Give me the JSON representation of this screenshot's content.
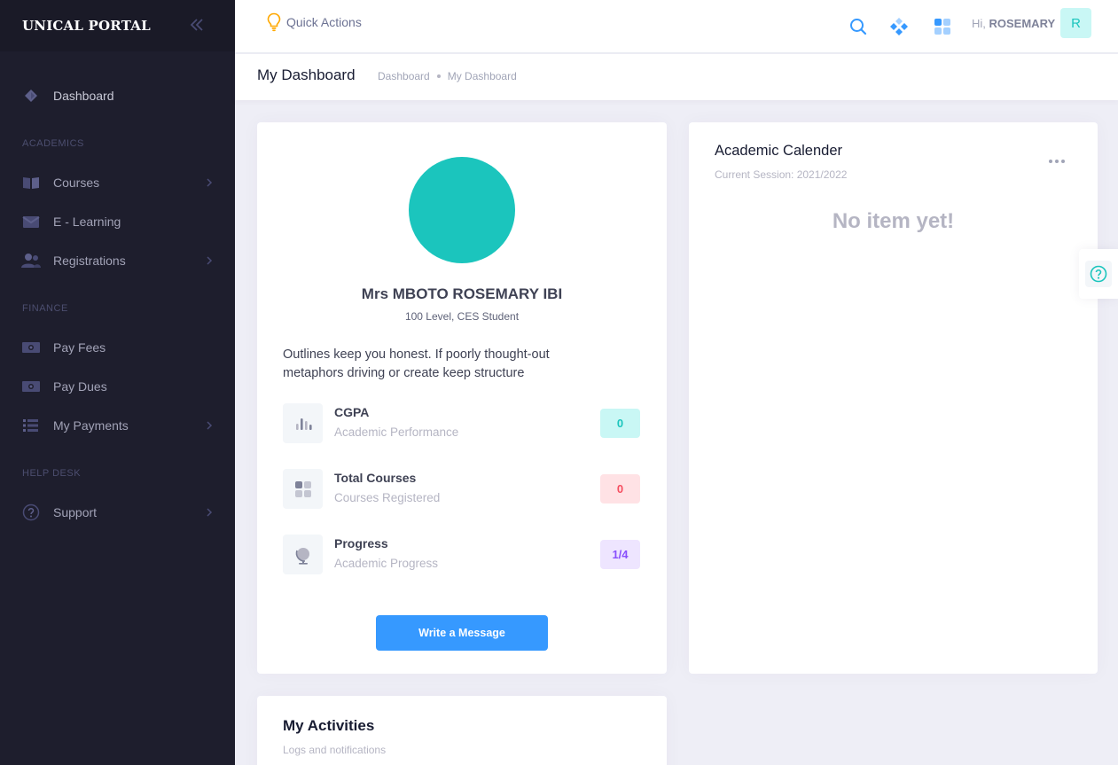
{
  "brand": {
    "name": "UNICAL PORTAL"
  },
  "sidebar": {
    "dashboard": {
      "label": "Dashboard"
    },
    "sections": {
      "academics": "ACADEMICS",
      "finance": "FINANCE",
      "help_desk": "HELP DESK"
    },
    "items": {
      "courses": "Courses",
      "elearning": "E - Learning",
      "registrations": "Registrations",
      "pay_fees": "Pay Fees",
      "pay_dues": "Pay Dues",
      "my_payments": "My Payments",
      "support": "Support"
    }
  },
  "header": {
    "quick_actions": "Quick Actions",
    "greeting_prefix": "Hi,",
    "user_name": "ROSEMARY",
    "avatar_letter": "R"
  },
  "subheader": {
    "title": "My Dashboard",
    "breadcrumb": [
      "Dashboard",
      "My Dashboard"
    ]
  },
  "profile": {
    "name": "Mrs MBOTO ROSEMARY IBI",
    "subtitle": "100 Level, CES Student",
    "bio": "Outlines keep you honest. If poorly thought-out metaphors driving or create keep structure",
    "stats": [
      {
        "title": "CGPA",
        "desc": "Academic Performance",
        "value": "0",
        "color": "#1bc5bd",
        "bg": "#c9f7f5"
      },
      {
        "title": "Total Courses",
        "desc": "Courses Registered",
        "value": "0",
        "color": "#f64e60",
        "bg": "#ffe2e5"
      },
      {
        "title": "Progress",
        "desc": "Academic Progress",
        "value": "1/4",
        "color": "#8950fc",
        "bg": "#eee5ff"
      }
    ],
    "message_button": "Write a Message"
  },
  "calendar": {
    "title": "Academic Calender",
    "session": "Current Session: 2021/2022",
    "empty_text": "No item yet!"
  },
  "activities": {
    "title": "My Activities",
    "subtitle": "Logs and notifications"
  },
  "icons": {
    "collapse": "double-chevron-left-icon",
    "search": "search-icon",
    "diamond": "diamond-cluster-icon",
    "apps": "apps-grid-icon",
    "help": "question-circle-icon"
  },
  "colors": {
    "sidebar_bg": "#1e1e2d",
    "accent_blue": "#3699ff",
    "teal": "#1bc5bd"
  }
}
